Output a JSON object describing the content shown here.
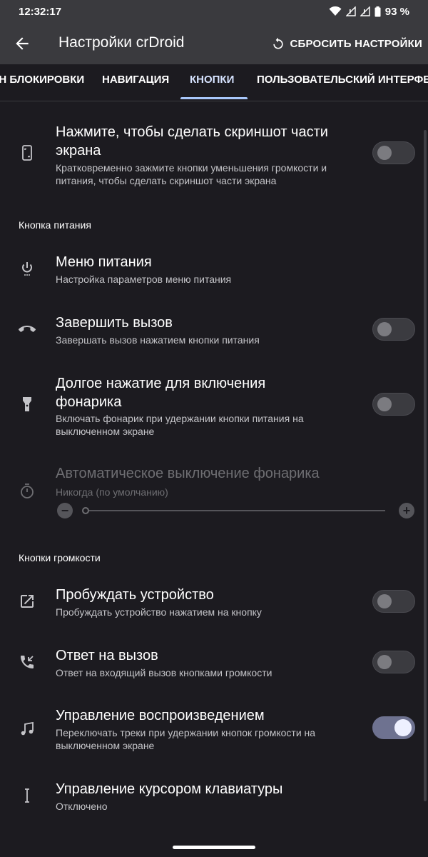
{
  "status_bar": {
    "time": "12:32:17",
    "battery": "93 %"
  },
  "app_bar": {
    "title": "Настройки crDroid",
    "reset_label": "СБРОСИТЬ НАСТРОЙКИ"
  },
  "tabs": [
    {
      "label": "ЭКРАН БЛОКИРОВКИ"
    },
    {
      "label": "НАВИГАЦИЯ"
    },
    {
      "label": "КНОПКИ",
      "active": true
    },
    {
      "label": "ПОЛЬЗОВАТЕЛЬСКИЙ ИНТЕРФЕЙС"
    }
  ],
  "items": {
    "screenshot": {
      "title_line1": "Нажмите, чтобы сделать скриншот части",
      "title_line2": "экрана",
      "summary_line1": "Кратковременно зажмите кнопки уменьшения громкости и",
      "summary_line2": "питания, чтобы сделать скриншот части экрана",
      "icon": "phone-screenshot-icon",
      "enabled": false
    },
    "power_menu": {
      "title": "Меню питания",
      "summary": "Настройка параметров меню питания",
      "icon": "power-icon"
    },
    "end_call": {
      "title": "Завершить вызов",
      "summary": "Завершать вызов нажатием кнопки питания",
      "icon": "call-end-icon",
      "enabled": false
    },
    "torch": {
      "title_line1": "Долгое нажатие для включения",
      "title_line2": "фонарика",
      "summary_line1": "Включать фонарик при удержании кнопки питания на",
      "summary_line2": "выключенном экране",
      "icon": "flashlight-icon",
      "enabled": false
    },
    "torch_timeout": {
      "title": "Автоматическое выключение фонарика",
      "summary": "Никогда (по умолчанию)",
      "icon": "timer-icon",
      "slider_value": 0
    },
    "wake": {
      "title": "Пробуждать устройство",
      "summary": "Пробуждать устройство нажатием на кнопку",
      "icon": "open-in-new-icon",
      "enabled": false
    },
    "answer_call": {
      "title": "Ответ на вызов",
      "summary": "Ответ на входящий вызов кнопками громкости",
      "icon": "phone-callback-icon",
      "enabled": false
    },
    "playback": {
      "title": "Управление воспроизведением",
      "summary_line1": "Переключать треки при удержании кнопок громкости на",
      "summary_line2": "выключенном экране",
      "icon": "music-note-icon",
      "enabled": true
    },
    "cursor": {
      "title": "Управление курсором клавиатуры",
      "summary": "Отключено",
      "icon": "text-cursor-icon"
    }
  },
  "sections": {
    "power_button": "Кнопка питания",
    "volume_buttons": "Кнопки громкости"
  }
}
